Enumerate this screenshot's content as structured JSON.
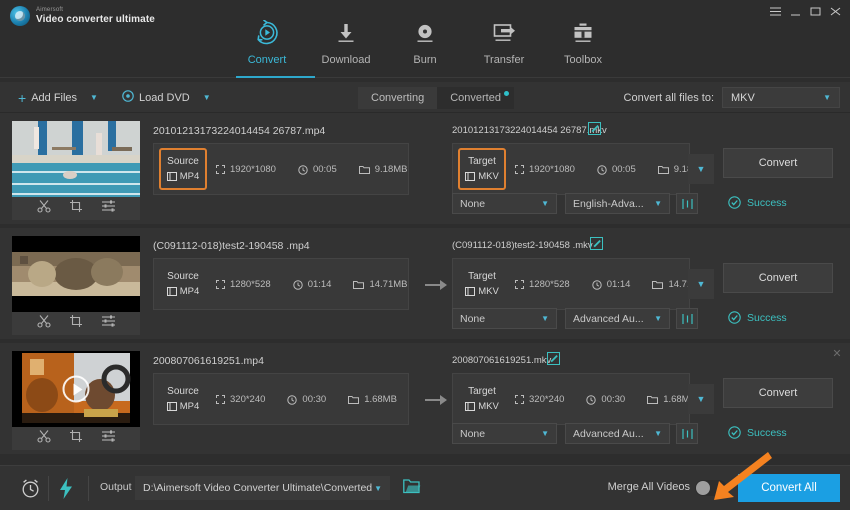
{
  "window": {
    "brand_top": "Aimersoft",
    "brand_bottom": "Video converter ultimate",
    "menu_icon": "hamburger-menu-icon",
    "minimize_icon": "minimize-icon",
    "maximize_icon": "maximize-icon",
    "close_icon": "close-icon"
  },
  "nav": {
    "items": [
      {
        "label": "Convert",
        "icon": "convert-icon",
        "active": true
      },
      {
        "label": "Download",
        "icon": "download-icon",
        "active": false
      },
      {
        "label": "Burn",
        "icon": "burn-icon",
        "active": false
      },
      {
        "label": "Transfer",
        "icon": "transfer-icon",
        "active": false
      },
      {
        "label": "Toolbox",
        "icon": "toolbox-icon",
        "active": false
      }
    ]
  },
  "toolbar": {
    "add_files": "Add Files",
    "load_dvd": "Load DVD",
    "tab_converting": "Converting",
    "tab_converted": "Converted",
    "converted_has_badge": true,
    "convert_all_to_label": "Convert all files to:",
    "convert_all_to_value": "MKV"
  },
  "files": [
    {
      "source_name": "20101213173224014454 26787.mp4",
      "target_name": "20101213173224014454 26787.mkv",
      "source_label": "Source",
      "target_label": "Target",
      "source_format": "MP4",
      "target_format": "MKV",
      "resolution": "1920*1080",
      "duration": "00:05",
      "size": "9.18MB",
      "subtitle": "None",
      "audio": "English-Adva...",
      "convert_label": "Convert",
      "status": "Success",
      "highlighted": true,
      "thumb": "pool-scene",
      "has_play_overlay": false,
      "has_close": false
    },
    {
      "source_name": "(C091112-018)test2-190458 .mp4",
      "target_name": "(C091112-018)test2-190458 .mkv",
      "source_label": "Source",
      "target_label": "Target",
      "source_format": "MP4",
      "target_format": "MKV",
      "resolution": "1280*528",
      "duration": "01:14",
      "size": "14.71MB",
      "subtitle": "None",
      "audio": "Advanced Au...",
      "convert_label": "Convert",
      "status": "Success",
      "highlighted": false,
      "thumb": "letterbox-scene",
      "has_play_overlay": false,
      "has_close": false
    },
    {
      "source_name": "200807061619251.mp4",
      "target_name": "200807061619251.mkv",
      "source_label": "Source",
      "target_label": "Target",
      "source_format": "MP4",
      "target_format": "MKV",
      "resolution": "320*240",
      "duration": "00:30",
      "size": "1.68MB",
      "subtitle": "None",
      "audio": "Advanced Au...",
      "convert_label": "Convert",
      "status": "Success",
      "highlighted": false,
      "thumb": "orange-scene",
      "has_play_overlay": true,
      "has_close": true
    }
  ],
  "thumb_tools": {
    "trim": "scissors-icon",
    "crop": "crop-icon",
    "effect": "effects-icon"
  },
  "bottom": {
    "timer_icon": "alarm-clock-icon",
    "speed_icon": "lightning-bolt-icon",
    "output_label": "Output",
    "output_path": "D:\\Aimersoft Video Converter Ultimate\\Converted",
    "folder_icon": "open-folder-icon",
    "merge_label": "Merge All Videos",
    "merge_on": false,
    "convert_all_button": "Convert All"
  },
  "annotation": {
    "arrow_color": "#f58220",
    "arrow_target": "convert-all-button"
  },
  "colors": {
    "accent": "#2ea8cc",
    "button_primary": "#1b9fe3",
    "success": "#3cc0c0",
    "highlight_border": "#e08030",
    "background": "#2d2d2d",
    "panel": "#333333"
  }
}
